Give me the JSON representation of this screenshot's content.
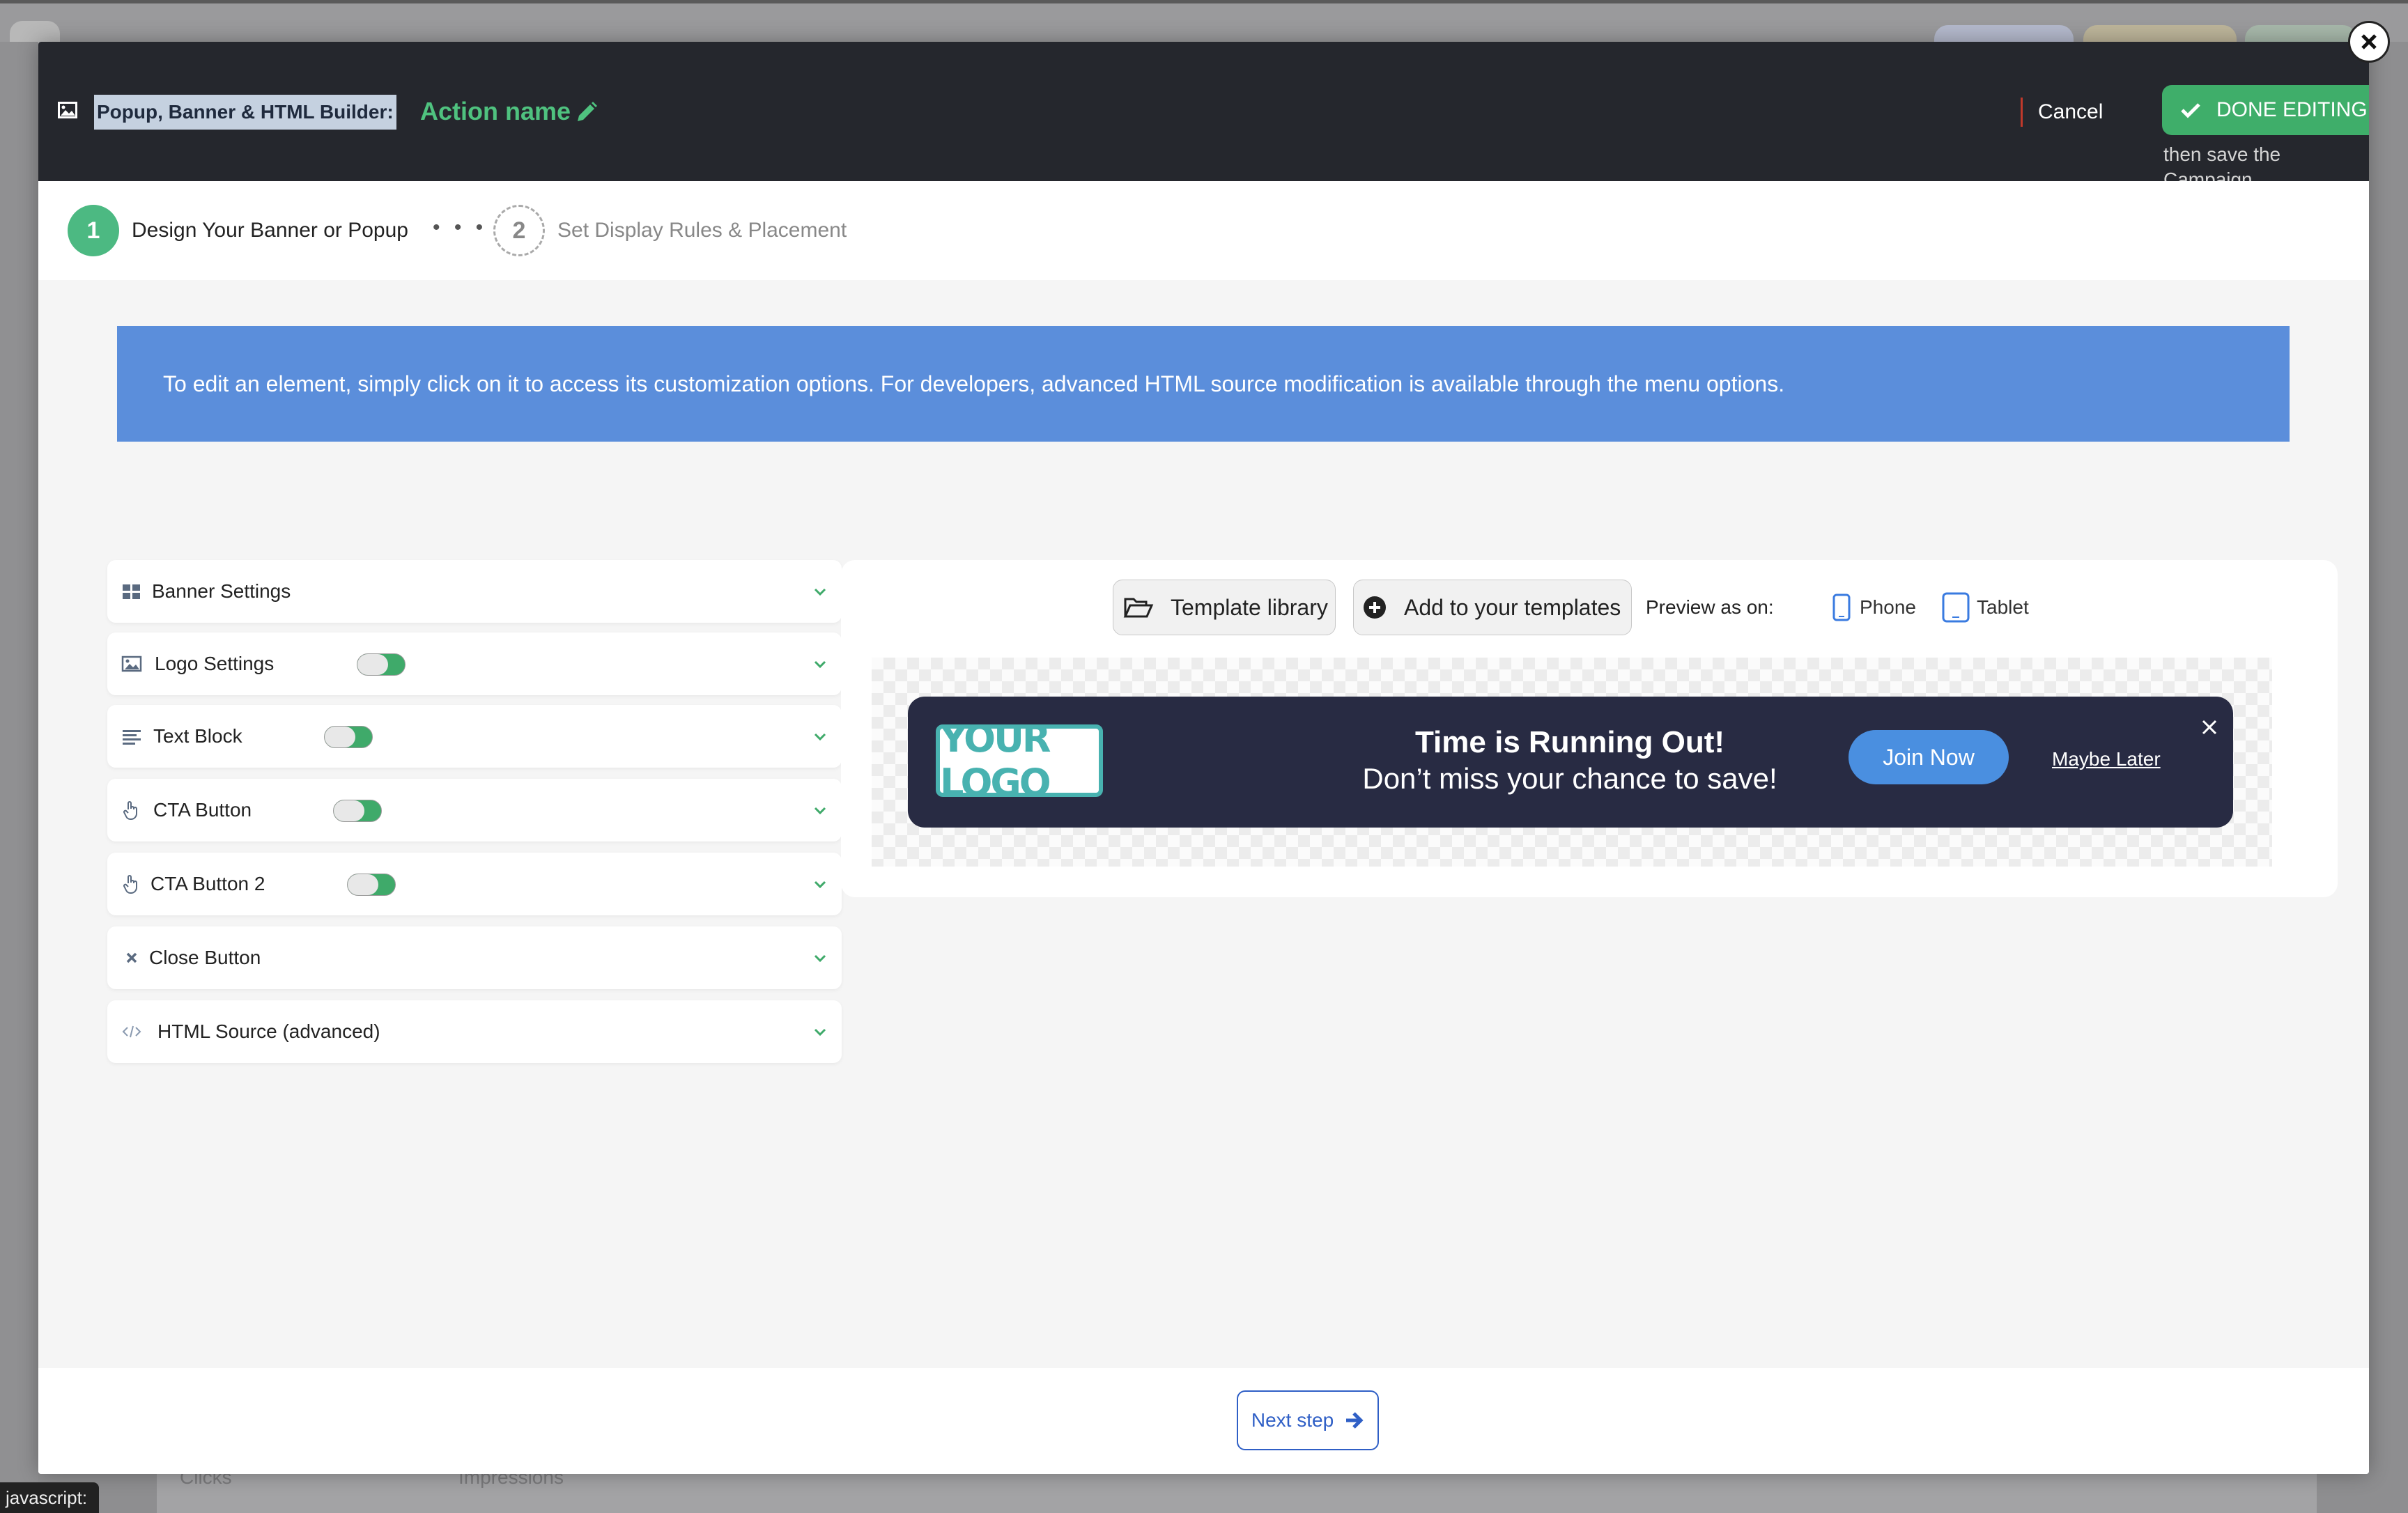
{
  "background": {
    "bottom_labels": [
      "Clicks",
      "Impressions"
    ],
    "status_bar_text": "javascript:"
  },
  "header": {
    "title": "Popup, Banner & HTML Builder:",
    "action_name": "Action name",
    "cancel_label": "Cancel",
    "done_label": "DONE EDITING",
    "done_subtext": "then save the Campaign"
  },
  "steps": [
    {
      "number": "1",
      "label": "Design Your Banner or Popup",
      "active": true
    },
    {
      "number": "2",
      "label": "Set Display Rules & Placement",
      "active": false
    }
  ],
  "steps_separator": "• • •",
  "info_text": "To edit an element, simply click on it to access its customization options. For developers, advanced HTML source modification is available through the menu options.",
  "panels": [
    {
      "label": "Banner Settings",
      "icon": "grid-icon",
      "toggle": false
    },
    {
      "label": "Logo Settings",
      "icon": "image-icon",
      "toggle": true
    },
    {
      "label": "Text Block",
      "icon": "text-align-icon",
      "toggle": true
    },
    {
      "label": "CTA Button",
      "icon": "pointer-hand-icon",
      "toggle": true
    },
    {
      "label": "CTA Button 2",
      "icon": "pointer-hand-icon",
      "toggle": true
    },
    {
      "label": "Close Button",
      "icon": "x-mark-icon",
      "toggle": false
    },
    {
      "label": "HTML Source (advanced)",
      "icon": "code-icon",
      "toggle": false
    }
  ],
  "preview": {
    "template_library_label": "Template library",
    "add_templates_label": "Add to your templates",
    "preview_as_label": "Preview as on:",
    "phone_label": "Phone",
    "tablet_label": "Tablet"
  },
  "banner": {
    "logo_text": "YOUR LOGO",
    "headline": "Time is Running Out!",
    "subline": "Don’t miss your chance to save!",
    "cta_label": "Join Now",
    "secondary_label": "Maybe Later"
  },
  "footer": {
    "next_label": "Next step"
  },
  "colors": {
    "accent_green": "#3fae6a",
    "info_blue": "#5b8edb",
    "banner_bg": "#282b43",
    "cta_blue": "#4a8fe0",
    "header_bg": "#25272d"
  }
}
